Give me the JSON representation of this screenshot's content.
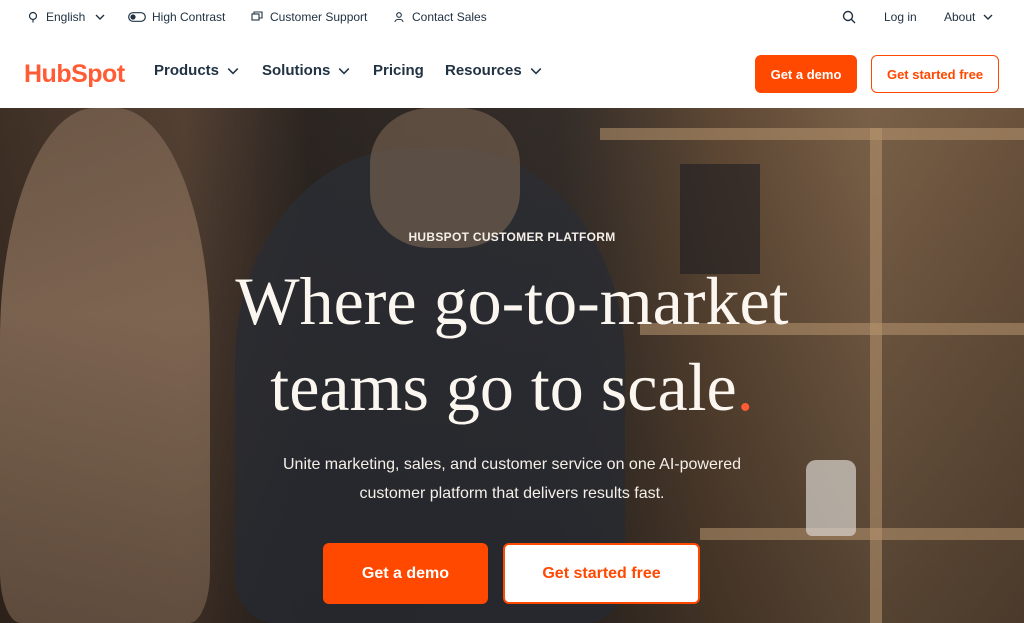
{
  "utility": {
    "language_label": "English",
    "high_contrast_label": "High Contrast",
    "support_label": "Customer Support",
    "sales_label": "Contact Sales",
    "login_label": "Log in",
    "about_label": "About"
  },
  "nav": {
    "logo_text": "HubSpot",
    "items": [
      {
        "label": "Products"
      },
      {
        "label": "Solutions"
      },
      {
        "label": "Pricing"
      },
      {
        "label": "Resources"
      }
    ],
    "demo_label": "Get a demo",
    "free_label": "Get started free"
  },
  "hero": {
    "eyebrow": "HUBSPOT CUSTOMER PLATFORM",
    "title_line1": "Where go-to-market",
    "title_line2": "teams go to scale",
    "title_dot": ".",
    "subtitle_line1": "Unite marketing, sales, and customer service on one AI-powered",
    "subtitle_line2": "customer platform that delivers results fast.",
    "demo_label": "Get a demo",
    "free_label": "Get started free"
  },
  "colors": {
    "accent": "#ff4800",
    "brand": "#ff5c35",
    "text_dark": "#213343"
  }
}
